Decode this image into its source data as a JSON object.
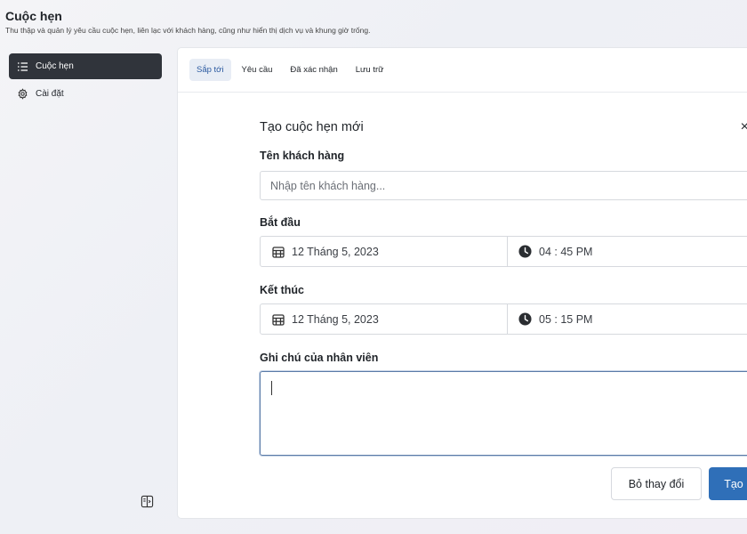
{
  "header": {
    "title": "Cuộc hẹn",
    "subtitle": "Thu thập và quản lý yêu cầu cuộc hẹn, liên lạc với khách hàng, cũng như hiển thị dịch vụ và khung giờ trống."
  },
  "sidebar": {
    "items": [
      {
        "label": "Cuộc hẹn",
        "icon": "list-icon",
        "active": true
      },
      {
        "label": "Cài đặt",
        "icon": "gear-icon",
        "active": false
      }
    ]
  },
  "tabs": [
    {
      "label": "Sắp tới",
      "active": true
    },
    {
      "label": "Yêu cầu",
      "active": false
    },
    {
      "label": "Đã xác nhận",
      "active": false
    },
    {
      "label": "Lưu trữ",
      "active": false
    }
  ],
  "dialog": {
    "title": "Tạo cuộc hẹn mới",
    "close": "×",
    "customer_label": "Tên khách hàng",
    "customer_placeholder": "Nhập tên khách hàng...",
    "start_label": "Bắt đầu",
    "start_date": "12 Tháng 5, 2023",
    "start_time": "04 : 45 PM",
    "end_label": "Kết thúc",
    "end_date": "12 Tháng 5, 2023",
    "end_time": "05 : 15 PM",
    "notes_label": "Ghi chú của nhân viên",
    "notes_value": "",
    "discard_label": "Bỏ thay đổi",
    "create_label": "Tạo"
  },
  "colors": {
    "sidebar_active": "#30343b",
    "tab_active_bg": "#e8edf5",
    "primary": "#2f6fb8",
    "focus_border": "#5b7ba8"
  }
}
